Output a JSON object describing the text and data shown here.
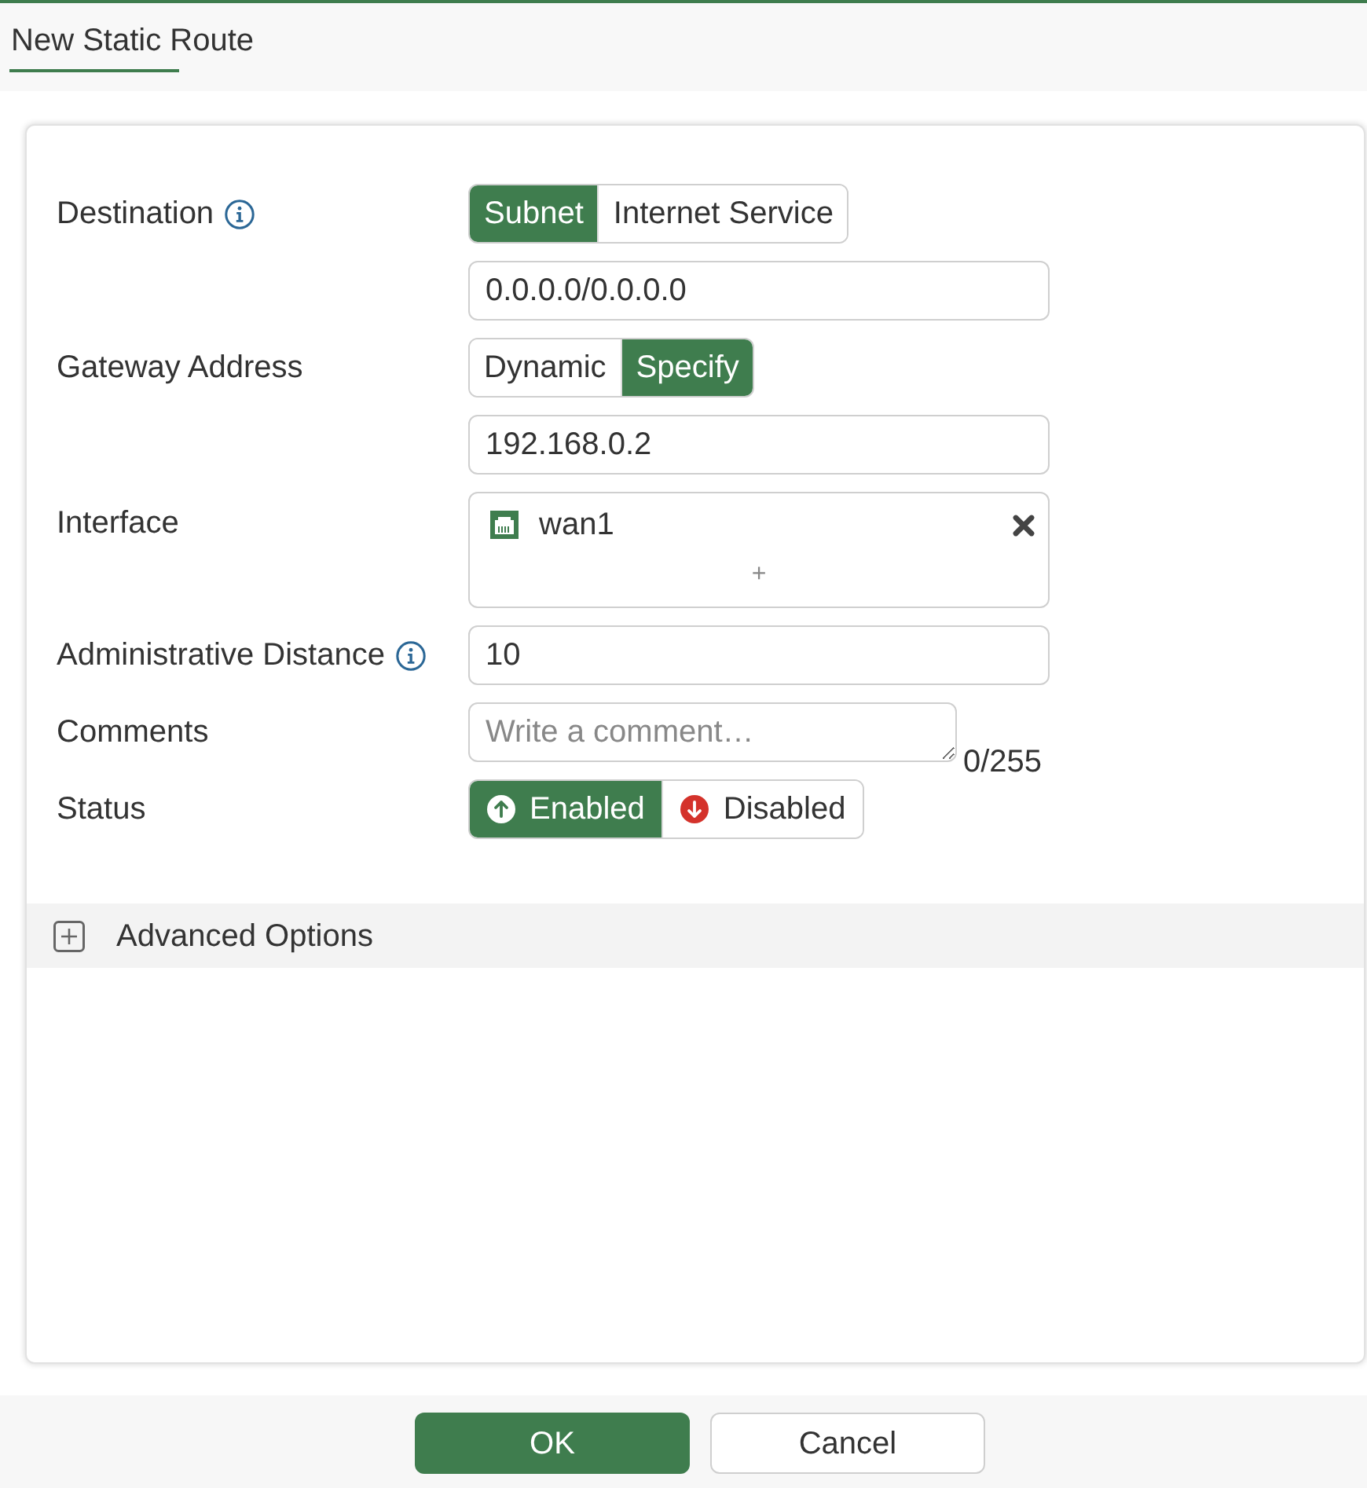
{
  "header": {
    "title": "New Static Route"
  },
  "form": {
    "fields": [
      {
        "kind": "toggle",
        "label": "Destination",
        "info": true,
        "options": [
          {
            "label": "Subnet",
            "selected": true
          },
          {
            "label": "Internet Service",
            "selected": false
          }
        ]
      },
      {
        "kind": "input",
        "value": "0.0.0.0/0.0.0.0"
      },
      {
        "kind": "toggle",
        "label": "Gateway Address",
        "options": [
          {
            "label": "Dynamic",
            "selected": false
          },
          {
            "label": "Specify",
            "selected": true
          }
        ]
      },
      {
        "kind": "input",
        "value": "192.168.0.2"
      },
      {
        "kind": "multiselect",
        "label": "Interface",
        "items": [
          {
            "label": "wan1"
          }
        ],
        "add": "+"
      },
      {
        "kind": "input",
        "label": "Administrative Distance",
        "info": true,
        "value": "10"
      },
      {
        "kind": "textarea",
        "label": "Comments",
        "placeholder": "Write a comment…",
        "counter": "0/255"
      },
      {
        "kind": "status",
        "label": "Status",
        "options": [
          {
            "label": "Enabled",
            "selected": true
          },
          {
            "label": "Disabled",
            "selected": false
          }
        ]
      }
    ]
  },
  "advanced": {
    "label": "Advanced Options",
    "expanded": false
  },
  "buttons": [
    {
      "label": "OK",
      "primary": true
    },
    {
      "label": "Cancel",
      "primary": false
    }
  ]
}
